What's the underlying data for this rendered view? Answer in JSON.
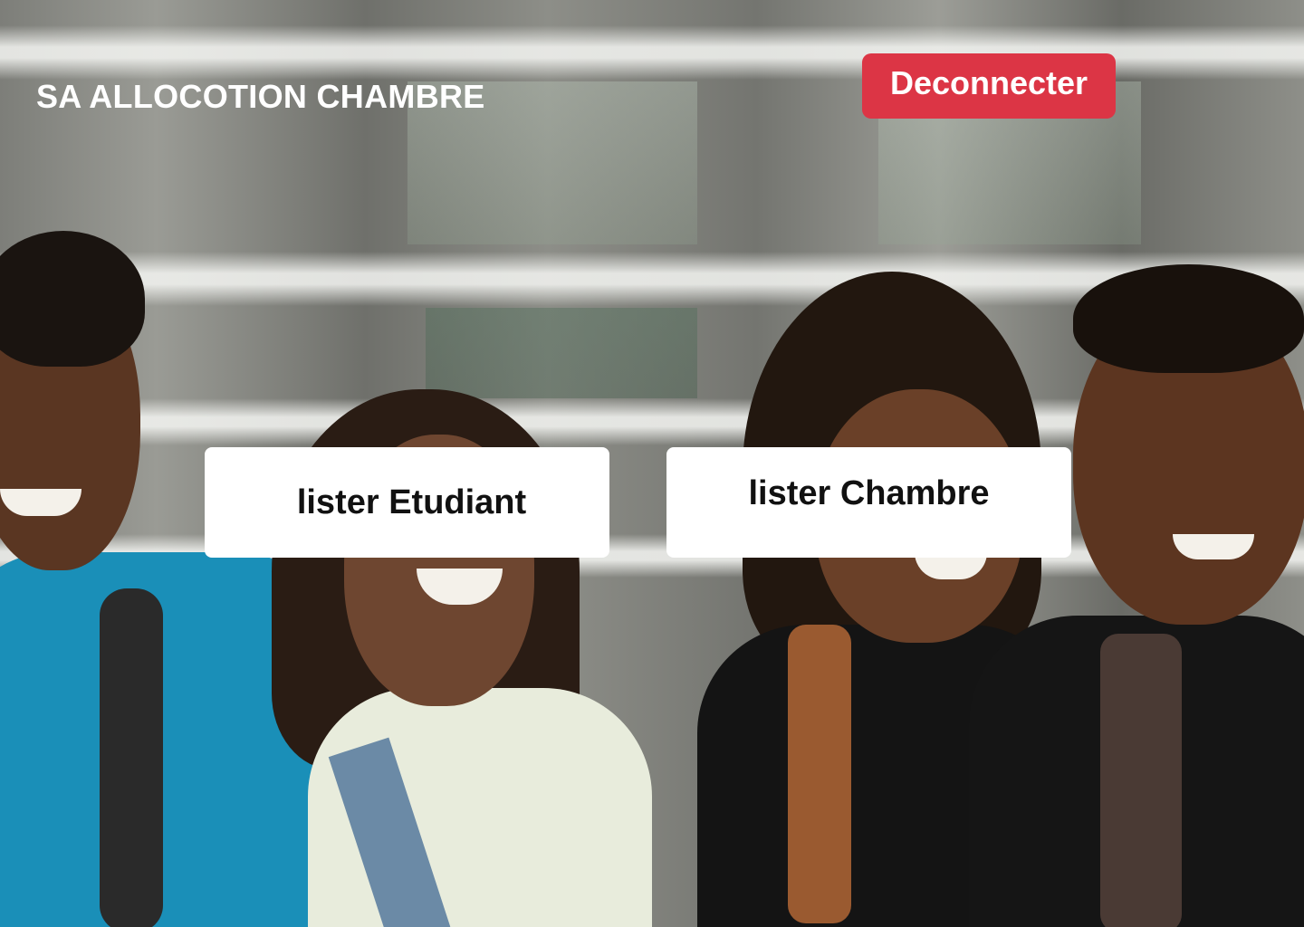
{
  "header": {
    "title": "SA ALLOCOTION CHAMBRE",
    "logout_label": "Deconnecter"
  },
  "menu": {
    "list_students_label": "lister Etudiant",
    "list_rooms_label": "lister Chambre"
  },
  "colors": {
    "logout_button": "#dc3545",
    "menu_button": "#ffffff",
    "title_text": "#ffffff"
  }
}
